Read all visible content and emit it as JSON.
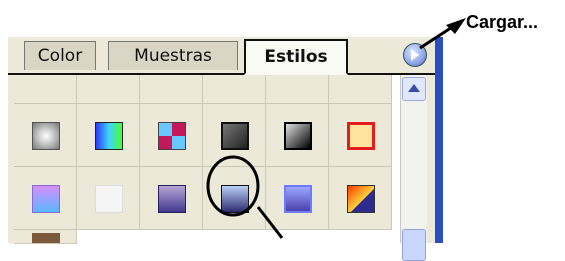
{
  "tabs": [
    {
      "label": "Color"
    },
    {
      "label": "Muestras"
    },
    {
      "label": "Estilos"
    }
  ],
  "callout": {
    "label": "Cargar..."
  },
  "swatches": [
    {
      "name": "style-sparkle",
      "colors": [
        "#d0d0d0",
        "#888888"
      ]
    },
    {
      "name": "style-rainbow",
      "colors": [
        "#2c39ff",
        "#49ff2f"
      ]
    },
    {
      "name": "style-pinwheel",
      "colors": [
        "#c3195b",
        "#67c7ff"
      ]
    },
    {
      "name": "style-dark-bevel",
      "colors": [
        "#222222",
        "#777777"
      ]
    },
    {
      "name": "style-black-glass",
      "colors": [
        "#000000",
        "#e0e0e0"
      ]
    },
    {
      "name": "style-red-frame",
      "colors": [
        "#e21d1d",
        "#ffe4a0"
      ]
    },
    {
      "name": "style-pink-button",
      "colors": [
        "#d590ff",
        "#5bb6ff"
      ]
    },
    {
      "name": "style-blank",
      "colors": [
        "#f5f5f5",
        "#dcdcdc"
      ]
    },
    {
      "name": "style-purple-gradient",
      "colors": [
        "#41378f",
        "#b7a6d4"
      ]
    },
    {
      "name": "style-blue-gradient-selected",
      "colors": [
        "#2e2a6e",
        "#b9d0f6"
      ]
    },
    {
      "name": "style-blue-inset",
      "colors": [
        "#4a41ad",
        "#9ca6ff"
      ]
    },
    {
      "name": "style-sunset",
      "colors": [
        "#ff3b00",
        "#ffd23a"
      ]
    }
  ]
}
